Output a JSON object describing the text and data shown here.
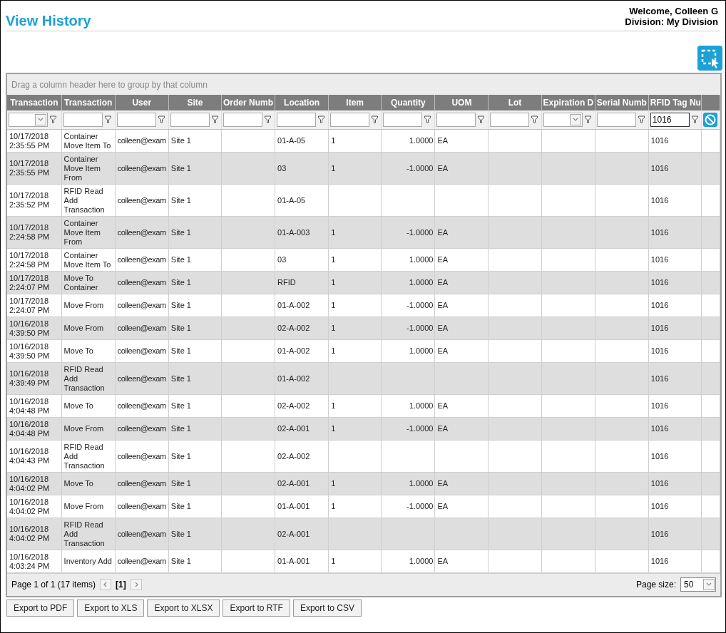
{
  "page": {
    "title": "View History",
    "welcome": "Welcome, Colleen G",
    "division": "Division: My Division"
  },
  "grid": {
    "group_hint": "Drag a column header here to group by that column",
    "columns": [
      {
        "label": "Transaction",
        "kind": "dropdown"
      },
      {
        "label": "Transaction",
        "kind": "text"
      },
      {
        "label": "User",
        "kind": "text"
      },
      {
        "label": "Site",
        "kind": "text"
      },
      {
        "label": "Order Numb",
        "kind": "text"
      },
      {
        "label": "Location",
        "kind": "text"
      },
      {
        "label": "Item",
        "kind": "text"
      },
      {
        "label": "Quantity",
        "kind": "text"
      },
      {
        "label": "UOM",
        "kind": "text"
      },
      {
        "label": "Lot",
        "kind": "text"
      },
      {
        "label": "Expiration D",
        "kind": "dropdown"
      },
      {
        "label": "Serial Numb",
        "kind": "text"
      },
      {
        "label": "RFID Tag Nu",
        "kind": "text",
        "filter_value": "1016"
      }
    ],
    "rows": [
      {
        "transaction_time": "10/17/2018 2:35:55 PM",
        "transaction_type": "Container Move Item To",
        "user": "colleen@exam",
        "site": "Site 1",
        "location": "01-A-05",
        "item": "1",
        "quantity": "1.0000",
        "uom": "EA",
        "rfid_tag": "1016"
      },
      {
        "transaction_time": "10/17/2018 2:35:55 PM",
        "transaction_type": "Container Move Item From",
        "user": "colleen@exam",
        "site": "Site 1",
        "location": "03",
        "item": "1",
        "quantity": "-1.0000",
        "uom": "EA",
        "rfid_tag": "1016"
      },
      {
        "transaction_time": "10/17/2018 2:35:52 PM",
        "transaction_type": "RFID Read Add Transaction",
        "user": "colleen@exam",
        "site": "Site 1",
        "location": "01-A-05",
        "rfid_tag": "1016"
      },
      {
        "transaction_time": "10/17/2018 2:24:58 PM",
        "transaction_type": "Container Move Item From",
        "user": "colleen@exam",
        "site": "Site 1",
        "location": "01-A-003",
        "item": "1",
        "quantity": "-1.0000",
        "uom": "EA",
        "rfid_tag": "1016"
      },
      {
        "transaction_time": "10/17/2018 2:24:58 PM",
        "transaction_type": "Container Move Item To",
        "user": "colleen@exam",
        "site": "Site 1",
        "location": "03",
        "item": "1",
        "quantity": "1.0000",
        "uom": "EA",
        "rfid_tag": "1016"
      },
      {
        "transaction_time": "10/17/2018 2:24:07 PM",
        "transaction_type": "Move To Container",
        "user": "colleen@exam",
        "site": "Site 1",
        "location": "RFID",
        "item": "1",
        "quantity": "1.0000",
        "uom": "EA",
        "rfid_tag": "1016"
      },
      {
        "transaction_time": "10/17/2018 2:24:07 PM",
        "transaction_type": "Move From",
        "user": "colleen@exam",
        "site": "Site 1",
        "location": "01-A-002",
        "item": "1",
        "quantity": "-1.0000",
        "uom": "EA",
        "rfid_tag": "1016"
      },
      {
        "transaction_time": "10/16/2018 4:39:50 PM",
        "transaction_type": "Move From",
        "user": "colleen@exam",
        "site": "Site 1",
        "location": "02-A-002",
        "item": "1",
        "quantity": "-1.0000",
        "uom": "EA",
        "rfid_tag": "1016"
      },
      {
        "transaction_time": "10/16/2018 4:39:50 PM",
        "transaction_type": "Move To",
        "user": "colleen@exam",
        "site": "Site 1",
        "location": "01-A-002",
        "item": "1",
        "quantity": "1.0000",
        "uom": "EA",
        "rfid_tag": "1016"
      },
      {
        "transaction_time": "10/16/2018 4:39:49 PM",
        "transaction_type": "RFID Read Add Transaction",
        "user": "colleen@exam",
        "site": "Site 1",
        "location": "01-A-002",
        "rfid_tag": "1016"
      },
      {
        "transaction_time": "10/16/2018 4:04:48 PM",
        "transaction_type": "Move To",
        "user": "colleen@exam",
        "site": "Site 1",
        "location": "02-A-002",
        "item": "1",
        "quantity": "1.0000",
        "uom": "EA",
        "rfid_tag": "1016"
      },
      {
        "transaction_time": "10/16/2018 4:04:48 PM",
        "transaction_type": "Move From",
        "user": "colleen@exam",
        "site": "Site 1",
        "location": "02-A-001",
        "item": "1",
        "quantity": "-1.0000",
        "uom": "EA",
        "rfid_tag": "1016"
      },
      {
        "transaction_time": "10/16/2018 4:04:43 PM",
        "transaction_type": "RFID Read Add Transaction",
        "user": "colleen@exam",
        "site": "Site 1",
        "location": "02-A-002",
        "rfid_tag": "1016"
      },
      {
        "transaction_time": "10/16/2018 4:04:02 PM",
        "transaction_type": "Move To",
        "user": "colleen@exam",
        "site": "Site 1",
        "location": "02-A-001",
        "item": "1",
        "quantity": "1.0000",
        "uom": "EA",
        "rfid_tag": "1016"
      },
      {
        "transaction_time": "10/16/2018 4:04:02 PM",
        "transaction_type": "Move From",
        "user": "colleen@exam",
        "site": "Site 1",
        "location": "01-A-001",
        "item": "1",
        "quantity": "-1.0000",
        "uom": "EA",
        "rfid_tag": "1016"
      },
      {
        "transaction_time": "10/16/2018 4:04:02 PM",
        "transaction_type": "RFID Read Add Transaction",
        "user": "colleen@exam",
        "site": "Site 1",
        "location": "02-A-001",
        "rfid_tag": "1016"
      },
      {
        "transaction_time": "10/16/2018 4:03:24 PM",
        "transaction_type": "Inventory Add",
        "user": "colleen@exam",
        "site": "Site 1",
        "location": "01-A-001",
        "item": "1",
        "quantity": "1.0000",
        "uom": "EA",
        "rfid_tag": "1016"
      }
    ],
    "pager": {
      "summary": "Page 1 of 1 (17 items)",
      "current_page": "[1]",
      "page_size_label": "Page size:",
      "page_size": "50"
    }
  },
  "export_buttons": [
    "Export to PDF",
    "Export to XLS",
    "Export to XLSX",
    "Export to RTF",
    "Export to CSV"
  ]
}
